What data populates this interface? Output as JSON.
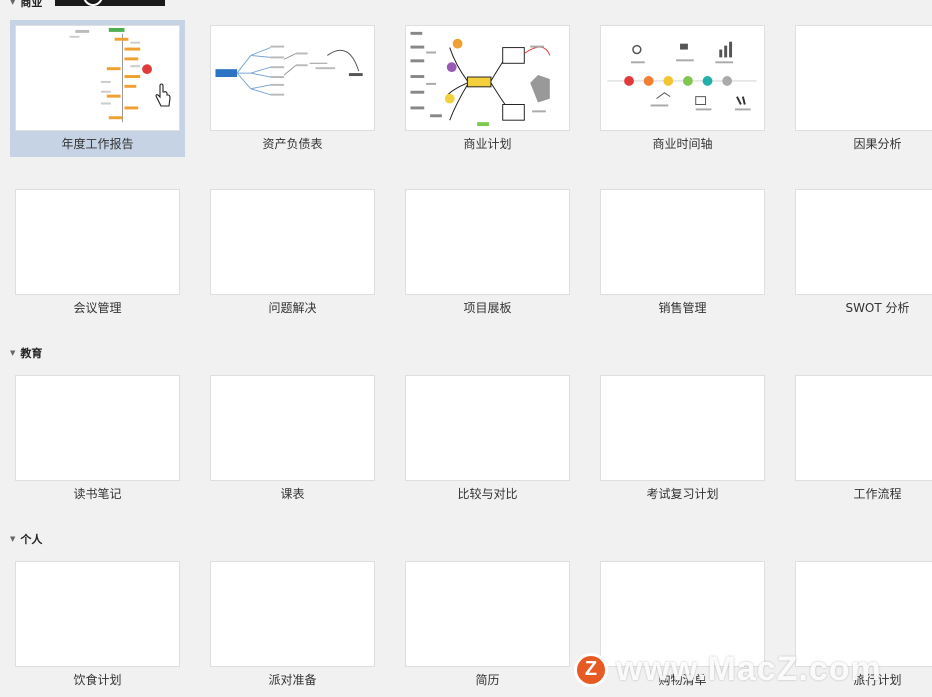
{
  "sections": [
    {
      "id": "business",
      "title": "商业"
    },
    {
      "id": "education",
      "title": "教育"
    },
    {
      "id": "personal",
      "title": "个人"
    }
  ],
  "templates": {
    "business_row1": [
      "年度工作报告",
      "资产负债表",
      "商业计划",
      "商业时间轴",
      "因果分析"
    ],
    "business_row2": [
      "会议管理",
      "问题解决",
      "项目展板",
      "销售管理",
      "SWOT 分析"
    ],
    "education": [
      "读书笔记",
      "课表",
      "比较与对比",
      "考试复习计划",
      "工作流程"
    ],
    "personal": [
      "饮食计划",
      "派对准备",
      "简历",
      "购物清单",
      "旅行计划"
    ]
  },
  "selected_template": "年度工作报告",
  "watermark": {
    "logo_letter": "Z",
    "text": "www.MacZ.com"
  },
  "colors": {
    "selected_bg": "#c5d3e4",
    "accent_orange": "#f0a030",
    "brand_blue": "#2c73c4",
    "watermark_logo": "#e85a23"
  }
}
